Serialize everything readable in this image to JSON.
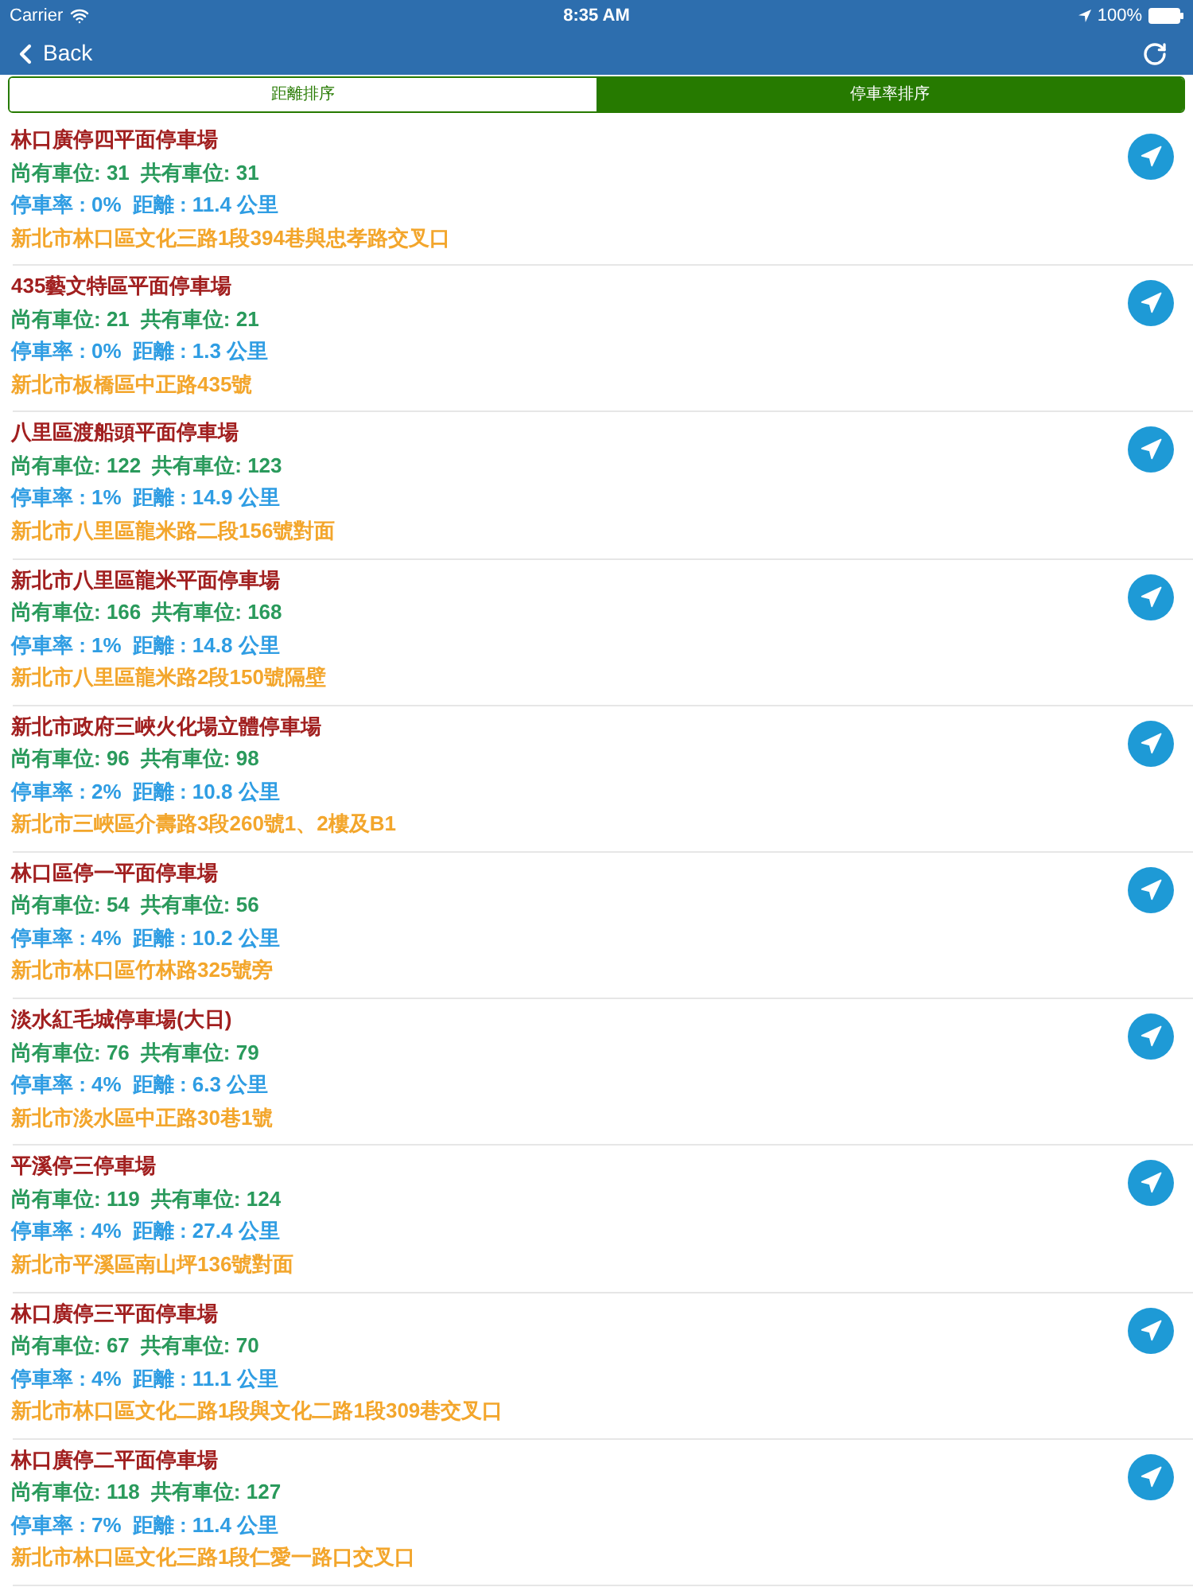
{
  "status_bar": {
    "carrier": "Carrier",
    "time": "8:35 AM",
    "battery": "100%"
  },
  "nav_bar": {
    "back": "Back"
  },
  "sort_tabs": [
    {
      "label": "距離排序",
      "selected": false
    },
    {
      "label": "停車率排序",
      "selected": true
    }
  ],
  "parking_lots": [
    {
      "name": "林口廣停四平面停車場",
      "available": "尚有車位: 31",
      "total": "共有車位: 31",
      "rate": "停車率 : 0%",
      "distance": "距離 : 11.4 公里",
      "address": "新北市林口區文化三路1段394巷與忠孝路交叉口"
    },
    {
      "name": "435藝文特區平面停車場",
      "available": "尚有車位: 21",
      "total": "共有車位: 21",
      "rate": "停車率 : 0%",
      "distance": "距離 : 1.3 公里",
      "address": "新北市板橋區中正路435號"
    },
    {
      "name": "八里區渡船頭平面停車場",
      "available": "尚有車位: 122",
      "total": "共有車位: 123",
      "rate": "停車率 : 1%",
      "distance": "距離 : 14.9 公里",
      "address": "新北市八里區龍米路二段156號對面"
    },
    {
      "name": "新北市八里區龍米平面停車場",
      "available": "尚有車位: 166",
      "total": "共有車位: 168",
      "rate": "停車率 : 1%",
      "distance": "距離 : 14.8 公里",
      "address": "新北市八里區龍米路2段150號隔壁"
    },
    {
      "name": "新北市政府三峽火化場立體停車場",
      "available": "尚有車位: 96",
      "total": "共有車位: 98",
      "rate": "停車率 : 2%",
      "distance": "距離 : 10.8 公里",
      "address": "新北市三峽區介壽路3段260號1、2樓及B1"
    },
    {
      "name": "林口區停一平面停車場",
      "available": "尚有車位: 54",
      "total": "共有車位: 56",
      "rate": "停車率 : 4%",
      "distance": "距離 : 10.2 公里",
      "address": "新北市林口區竹林路325號旁"
    },
    {
      "name": "淡水紅毛城停車場(大日)",
      "available": "尚有車位: 76",
      "total": "共有車位: 79",
      "rate": "停車率 : 4%",
      "distance": "距離 : 6.3 公里",
      "address": "新北市淡水區中正路30巷1號"
    },
    {
      "name": "平溪停三停車場",
      "available": "尚有車位: 119",
      "total": "共有車位: 124",
      "rate": "停車率 : 4%",
      "distance": "距離 : 27.4 公里",
      "address": "新北市平溪區南山坪136號對面"
    },
    {
      "name": "林口廣停三平面停車場",
      "available": "尚有車位: 67",
      "total": "共有車位: 70",
      "rate": "停車率 : 4%",
      "distance": "距離 : 11.1 公里",
      "address": "新北市林口區文化二路1段與文化二路1段309巷交叉口"
    },
    {
      "name": "林口廣停二平面停車場",
      "available": "尚有車位: 118",
      "total": "共有車位: 127",
      "rate": "停車率 : 7%",
      "distance": "距離 : 11.4 公里",
      "address": "新北市林口區文化三路1段仁愛一路口交叉口"
    }
  ]
}
